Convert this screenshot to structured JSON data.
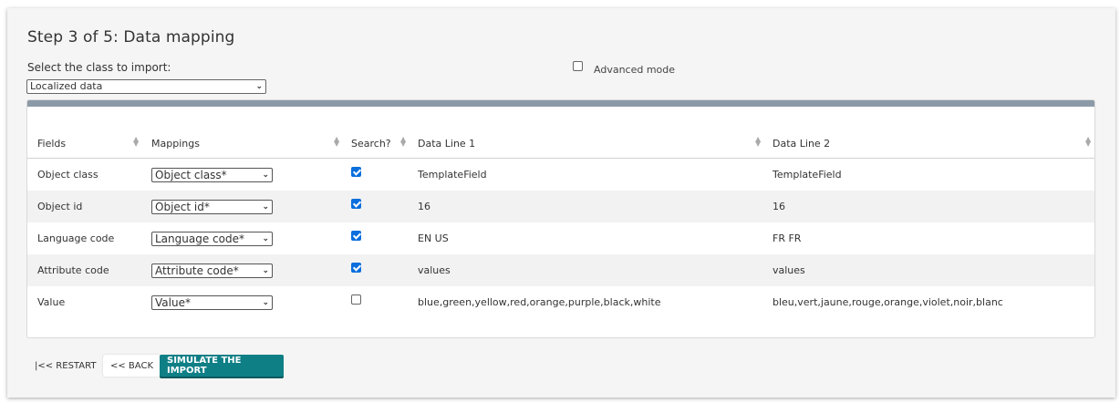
{
  "page": {
    "title": "Step 3 of 5: Data mapping",
    "class_label": "Select the class to import:",
    "class_value": "Localized data",
    "advanced_mode_label": "Advanced mode",
    "advanced_mode_checked": false
  },
  "table": {
    "headers": [
      "Fields",
      "Mappings",
      "Search?",
      "Data Line 1",
      "Data Line 2"
    ],
    "rows": [
      {
        "field": "Object class",
        "mapping": "Object class*",
        "search": true,
        "line1": "TemplateField",
        "line2": "TemplateField"
      },
      {
        "field": "Object id",
        "mapping": "Object id*",
        "search": true,
        "line1": "16",
        "line2": "16"
      },
      {
        "field": "Language code",
        "mapping": "Language code*",
        "search": true,
        "line1": "EN US",
        "line2": "FR FR"
      },
      {
        "field": "Attribute code",
        "mapping": "Attribute code*",
        "search": true,
        "line1": "values",
        "line2": "values"
      },
      {
        "field": "Value",
        "mapping": "Value*",
        "search": false,
        "line1": "blue,green,yellow,red,orange,purple,black,white",
        "line2": "bleu,vert,jaune,rouge,orange,violet,noir,blanc"
      }
    ]
  },
  "buttons": {
    "restart": "|<< RESTART",
    "back": "<< BACK",
    "simulate": "SIMULATE THE IMPORT"
  },
  "colors": {
    "accent": "#0f7f86",
    "checkbox": "#0a6fdc",
    "table_bar": "#8c9aa8"
  }
}
